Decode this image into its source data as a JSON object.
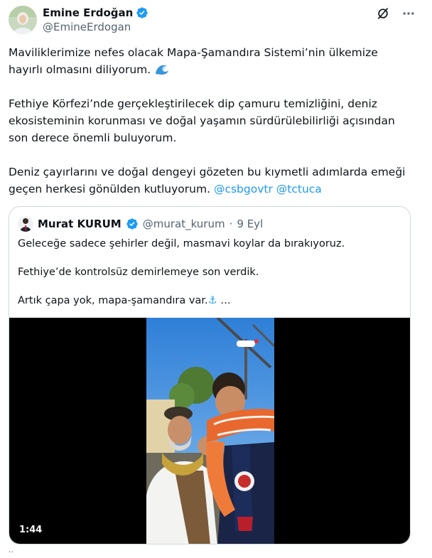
{
  "author": {
    "name": "Emine Erdoğan",
    "handle": "@EmineErdogan"
  },
  "icons": {
    "verified": "verified-badge-icon",
    "grok": "grok-icon",
    "more": "more-icon",
    "wave": "wave-emoji-icon",
    "anchor": "anchor-emoji-icon",
    "verified_color": "#1d9bf0"
  },
  "tweet": {
    "p1_line1": "Maviliklerimize nefes olacak Mapa-Şamandıra Sistemi’nin ülkemize",
    "p1_line2": "hayırlı olmasını diliyorum.",
    "p2": "Fethiye Körfezi’nde gerçekleştirilecek dip çamuru temizliğini, deniz ekosisteminin korunması ve doğal yaşamın sürdürülebilirliği açısından son derece önemli buluyorum.",
    "p3": "Deniz çayırlarını ve doğal dengeyi gözeten bu kıymetli adımlarda emeği geçen herkesi gönülden kutluyorum.",
    "mention1": "@csbgovtr",
    "mention2": "@tctuca"
  },
  "quote": {
    "name": "Murat KURUM",
    "handle": "@murat_kurum",
    "separator": "·",
    "date": "9 Eyl",
    "line1": "Geleceğe sadece şehirler değil, masmavi koylar da bırakıyoruz.",
    "line2": "Fethiye’de kontrolsüz demirlemeye son verdik.",
    "line3": "Artık çapa yok, mapa-şamandıra var.",
    "ellipsis": " …",
    "video_duration": "1:44"
  },
  "footer": {
    "dots": "··"
  }
}
